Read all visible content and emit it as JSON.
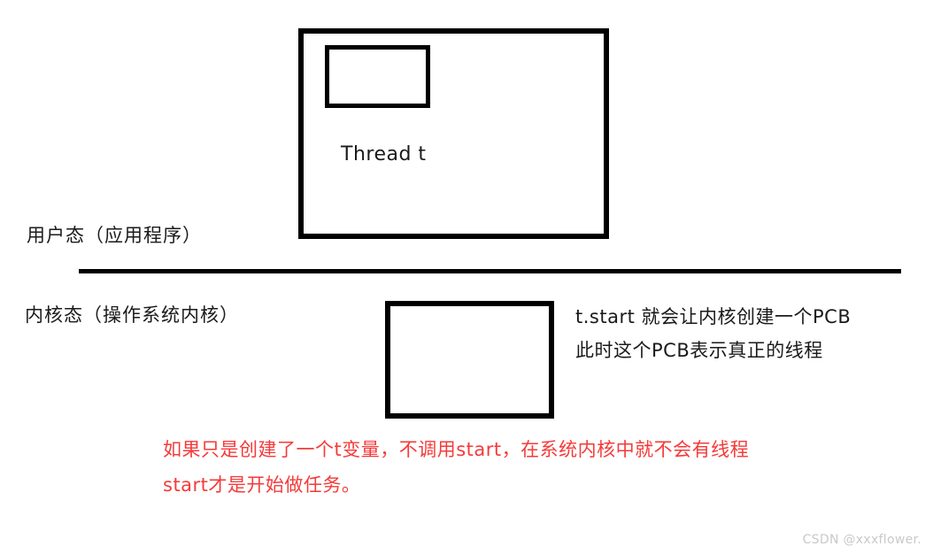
{
  "diagram": {
    "user_space": {
      "process_box_name": "user-process-box",
      "thread_object_box_name": "thread-object-box",
      "thread_label": "Thread t"
    },
    "kernel_space": {
      "pcb_box_name": "pcb-box"
    },
    "mode_labels": {
      "user_mode": "用户态（应用程序）",
      "kernel_mode": "内核态（操作系统内核）"
    },
    "divider": {
      "name": "mode-divider",
      "color": "#000000"
    },
    "pcb_notes": [
      "t.start  就会让内核创建一个PCB",
      "此时这个PCB表示真正的线程"
    ],
    "warning_notes": [
      "如果只是创建了一个t变量，不调用start，在系统内核中就不会有线程",
      "start才是开始做任务。"
    ],
    "colors": {
      "stroke": "#000000",
      "text": "#1a1a1a",
      "warning": "#f53a3a",
      "watermark": "#c9c9c9",
      "background": "#ffffff"
    }
  },
  "watermark": {
    "text": "CSDN @xxxflower."
  }
}
